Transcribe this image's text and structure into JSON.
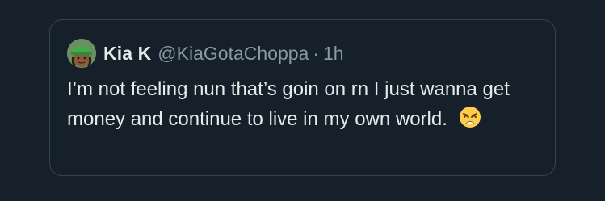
{
  "quote_tweet": {
    "author": {
      "display_name": "Kia K",
      "handle": "@KiaGotaChoppa",
      "separator": "·",
      "time": "1h"
    },
    "text": "I’m not feeling nun that’s goin on rn I just wanna get money and continue to live in my own world.",
    "emoji": "weary-face-emoji"
  },
  "colors": {
    "background": "#15202b",
    "border": "#38444d",
    "primary_text": "#e7e9ea",
    "secondary_text": "#8b98a5"
  }
}
